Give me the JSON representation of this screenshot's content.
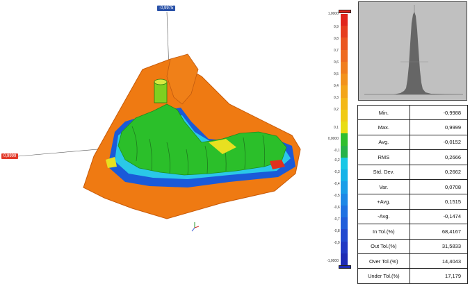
{
  "viewport": {
    "callouts": {
      "top_value": "-0,9975",
      "left_value": "0,9999"
    },
    "colors": {
      "surface_orange": "#ef7a12",
      "surface_green": "#2bbf2a",
      "surface_blue": "#1a5ad8",
      "surface_cyan": "#2ac8e8",
      "surface_red": "#e0301e",
      "surface_yellow": "#e8e020",
      "callout_blue": "#2a52a8",
      "callout_red": "#e23a2a"
    }
  },
  "color_scale": {
    "top_value": "1,0000",
    "bottom_value": "-1,0000",
    "center_value": "0,0000",
    "upper_tol": "0,1",
    "lower_tol": "-0,1",
    "tick_labels": [
      "0,9",
      "0,8",
      "0,7",
      "0,6",
      "0,5",
      "0,4",
      "0,3",
      "0,2",
      "-0,2",
      "-0,3",
      "-0,4",
      "-0,5",
      "-0,6",
      "-0,7",
      "-0,8",
      "-0,9"
    ],
    "segment_colors": [
      "#e1251b",
      "#e63d1e",
      "#ea5520",
      "#ee6a20",
      "#f07e1e",
      "#f2921c",
      "#f3a51a",
      "#f3b818",
      "#f0cb14",
      "#e8dd12",
      "#2fbf2e",
      "#27b34a",
      "#19c8e6",
      "#15b3e8",
      "#1a9ee8",
      "#1d88e6",
      "#1f72e2",
      "#205edb",
      "#2149d0",
      "#2038c4",
      "#1d2ab4"
    ]
  },
  "histogram": {
    "background": "#c0c0c0"
  },
  "stats": {
    "rows": [
      {
        "label": "Min.",
        "value": "-0,9988"
      },
      {
        "label": "Max.",
        "value": "0,9999"
      },
      {
        "label": "Avg.",
        "value": "-0,0152"
      },
      {
        "label": "RMS",
        "value": "0,2666"
      },
      {
        "label": "Std. Dev.",
        "value": "0,2662"
      },
      {
        "label": "Var.",
        "value": "0,0708"
      },
      {
        "label": "+Avg.",
        "value": "0,1515"
      },
      {
        "label": "-Avg.",
        "value": "-0,1474"
      },
      {
        "label": "In Tol.(%)",
        "value": "68,4167"
      },
      {
        "label": "Out Tol.(%)",
        "value": "31,5833"
      },
      {
        "label": "Over Tol.(%)",
        "value": "14,4043"
      },
      {
        "label": "Under Tol.(%)",
        "value": "17,179"
      }
    ]
  }
}
